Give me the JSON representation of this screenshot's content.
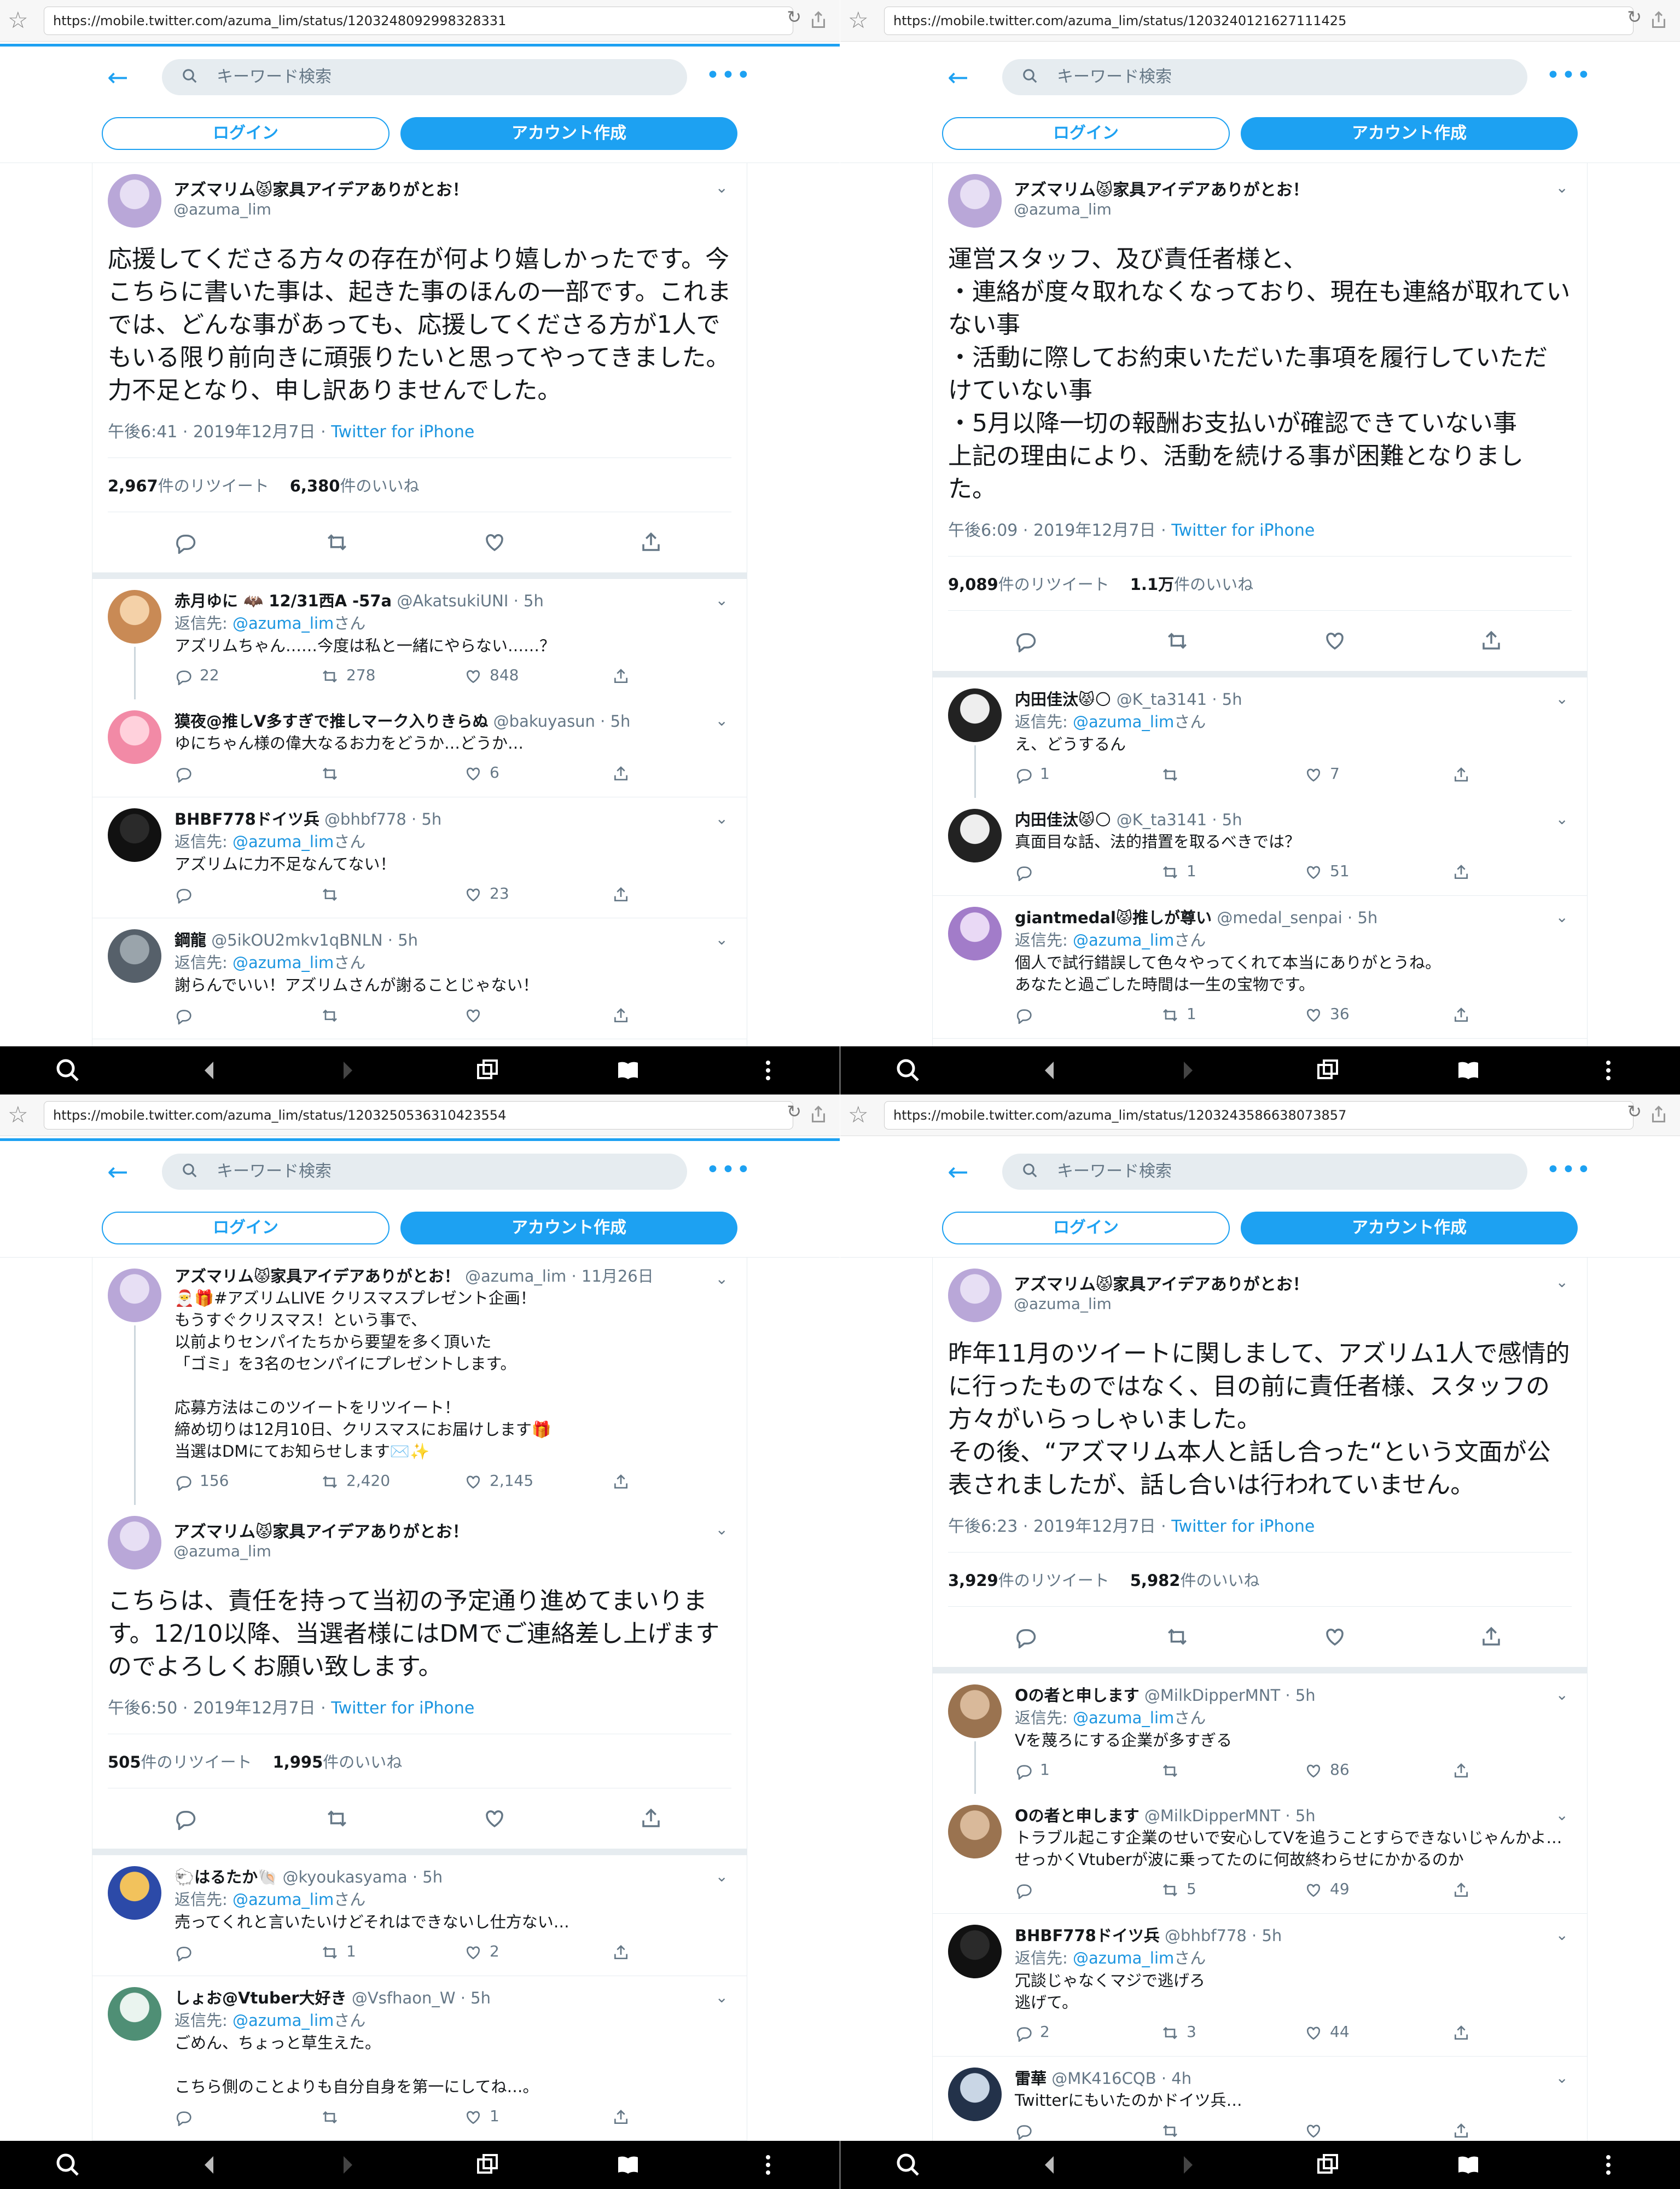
{
  "ui": {
    "search_placeholder": "キーワード検索",
    "login": "ログイン",
    "create": "アカウント作成",
    "reply_prefix": "返信先: ",
    "reply_suffix": "さん",
    "retweets_label": "件のリツイート",
    "likes_label": "件のいいね",
    "more_dots": "•••",
    "back_arrow": "←",
    "caret": "⌄",
    "star": "☆",
    "reload": "↻"
  },
  "colors": {
    "accent": "#1da1f2",
    "link": "#1b95e0",
    "muted": "#657786",
    "border": "#e6ecf0"
  },
  "panes": [
    {
      "url": "https://mobile.twitter.com/azuma_lim/status/1203248092998328331",
      "main": {
        "name": "アズマリム😾家具アイデアありがとお！",
        "handle": "@azuma_lim",
        "text": "応援してくださる方々の存在が何より嬉しかったです。今こちらに書いた事は、起きた事のほんの一部です。これまでは、どんな事があっても、応援してくださる方が1人でもいる限り前向きに頑張りたいと思ってやってきました。\n力不足となり、申し訳ありませんでした。",
        "time": "午後6:41 · 2019年12月7日 · ",
        "via": "Twitter for iPhone",
        "retweets": "2,967",
        "likes": "6,380"
      },
      "replies": [
        {
          "name": "赤月ゆに 🦇 12/31西A -57a",
          "handle": "@AkatsukiUNI · 5h",
          "to": "@azuma_lim",
          "text": "アズリムちゃん……今度は私と一緒にやらない……？",
          "c1": "22",
          "c2": "278",
          "c3": "848",
          "thread": true
        },
        {
          "name": "獏夜@推しV多すぎで推しマーク入りきらぬ",
          "handle": "@bakuyasun · 5h",
          "to": "",
          "text": "ゆにちゃん様の偉大なるお力をどうか…どうか…",
          "c1": "",
          "c2": "",
          "c3": "6"
        },
        {
          "name": "BHBF778ドイツ兵",
          "handle": "@bhbf778 · 5h",
          "to": "@azuma_lim",
          "text": "アズリムに力不足なんてない！",
          "c1": "",
          "c2": "",
          "c3": "23"
        },
        {
          "name": "鋼龍",
          "handle": "@5ikOU2mkv1qBNLN · 5h",
          "to": "@azuma_lim",
          "text": "謝らんでいい！アズリムさんが謝ることじゃない！",
          "c1": "",
          "c2": "",
          "c3": ""
        }
      ]
    },
    {
      "url": "https://mobile.twitter.com/azuma_lim/status/1203240121627111425",
      "main": {
        "name": "アズマリム😾家具アイデアありがとお！",
        "handle": "@azuma_lim",
        "text": "運営スタッフ、及び責任者様と、\n・連絡が度々取れなくなっており、現在も連絡が取れていない事\n・活動に際してお約束いただいた事項を履行していただけていない事\n・5月以降一切の報酬お支払いが確認できていない事\n上記の理由により、活動を続ける事が困難となりました。",
        "time": "午後6:09 · 2019年12月7日 · ",
        "via": "Twitter for iPhone",
        "retweets": "9,089",
        "likes": "1.1万"
      },
      "replies": [
        {
          "name": "内田佳汰😾🌕",
          "handle": "@K_ta3141 · 5h",
          "to": "@azuma_lim",
          "text": "え、どうするん",
          "c1": "1",
          "c2": "",
          "c3": "7",
          "thread": true
        },
        {
          "name": "内田佳汰😾🌕",
          "handle": "@K_ta3141 · 5h",
          "to": "",
          "text": "真面目な話、法的措置を取るべきでは？",
          "c1": "",
          "c2": "1",
          "c3": "51"
        },
        {
          "name": "giantmedal😾推しが尊い",
          "handle": "@medal_senpai · 5h",
          "to": "@azuma_lim",
          "text": "個人で試行錯誤して色々やってくれて本当にありがとうね。\nあなたと過ごした時間は一生の宝物です。",
          "c1": "",
          "c2": "1",
          "c3": "36"
        }
      ]
    },
    {
      "url": "https://mobile.twitter.com/azuma_lim/status/1203250536310423554",
      "quoted": {
        "name": "アズマリム😾家具アイデアありがとお！",
        "handle": "@azuma_lim · 11月26日",
        "text": "🎅🎁#アズリムLIVE クリスマスプレゼント企画！\nもうすぐクリスマス！という事で、\n以前よりセンパイたちから要望を多く頂いた\n「ゴミ」を3名のセンパイにプレゼントします。\n\n応募方法はこのツイートをリツイート！\n締め切りは12月10日、クリスマスにお届けします🎁\n当選はDMにてお知らせします✉️✨",
        "c1": "156",
        "c2": "2,420",
        "c3": "2,145"
      },
      "main": {
        "name": "アズマリム😾家具アイデアありがとお！",
        "handle": "@azuma_lim",
        "text": "こちらは、責任を持って当初の予定通り進めてまいります。12/10以降、当選者様にはDMでご連絡差し上げますのでよろしくお願い致します。",
        "time": "午後6:50 · 2019年12月7日 · ",
        "via": "Twitter for iPhone",
        "retweets": "505",
        "likes": "1,995"
      },
      "replies": [
        {
          "name": "🐑はるたか🐚",
          "handle": "@kyoukasyama · 5h",
          "to": "@azuma_lim",
          "text": "売ってくれと言いたいけどそれはできないし仕方ない…",
          "c1": "",
          "c2": "1",
          "c3": "2"
        },
        {
          "name": "しょお@Vtuber大好き",
          "handle": "@Vsfhaon_W · 5h",
          "to": "@azuma_lim",
          "text": "ごめん、ちょっと草生えた。\n\nこちら側のことよりも自分自身を第一にしてね…。",
          "c1": "",
          "c2": "",
          "c3": "1"
        }
      ]
    },
    {
      "url": "https://mobile.twitter.com/azuma_lim/status/1203243586638073857",
      "main": {
        "name": "アズマリム😾家具アイデアありがとお！",
        "handle": "@azuma_lim",
        "text": "昨年11月のツイートに関しまして、アズリム1人で感情的に行ったものではなく、目の前に責任者様、スタッフの方々がいらっしゃいました。\nその後、“アズマリム本人と話し合った“という文面が公表されましたが、話し合いは行われていません。",
        "time": "午後6:23 · 2019年12月7日 · ",
        "via": "Twitter for iPhone",
        "retweets": "3,929",
        "likes": "5,982"
      },
      "replies": [
        {
          "name": "Oの者と申します",
          "handle": "@MilkDipperMNT · 5h",
          "to": "@azuma_lim",
          "text": "Vを蔑ろにする企業が多すぎる",
          "c1": "1",
          "c2": "",
          "c3": "86",
          "thread": true
        },
        {
          "name": "Oの者と申します",
          "handle": "@MilkDipperMNT · 5h",
          "to": "",
          "text": "トラブル起こす企業のせいで安心してVを追うことすらできないじゃんかよ…\nせっかくVtuberが波に乗ってたのに何故終わらせにかかるのか",
          "c1": "",
          "c2": "5",
          "c3": "49"
        },
        {
          "name": "BHBF778ドイツ兵",
          "handle": "@bhbf778 · 5h",
          "to": "@azuma_lim",
          "text": "冗談じゃなくマジで逃げろ\n逃げて。",
          "c1": "2",
          "c2": "3",
          "c3": "44"
        },
        {
          "name": "雷華",
          "handle": "@MK416CQB · 4h",
          "to": "",
          "text": "Twitterにもいたのかドイツ兵…",
          "c1": "",
          "c2": "",
          "c3": ""
        }
      ]
    }
  ]
}
